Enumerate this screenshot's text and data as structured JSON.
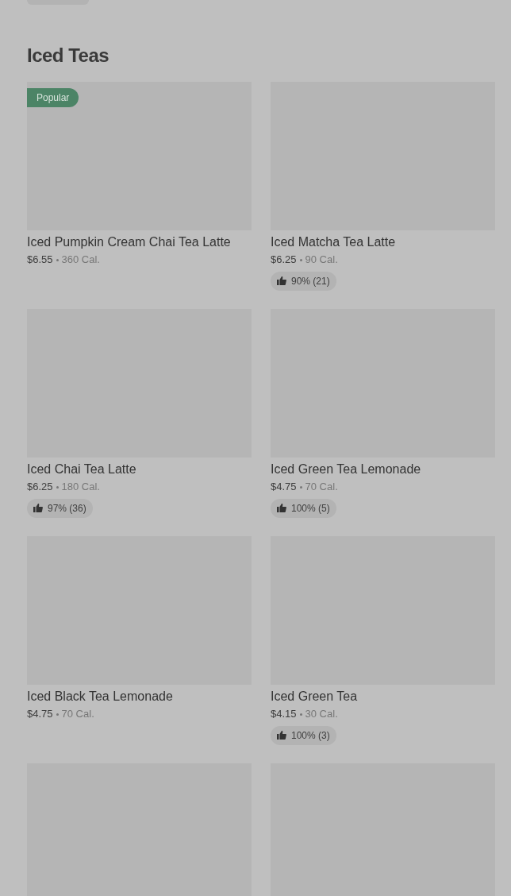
{
  "section": {
    "title": "Iced Teas"
  },
  "items": [
    {
      "kind": "product",
      "badge": "Popular",
      "name": "Iced Pumpkin Cream Chai Tea Latte",
      "price": "$6.55",
      "calories": "360 Cal."
    },
    {
      "kind": "product",
      "name": "Iced Matcha Tea Latte",
      "price": "$6.25",
      "calories": "90 Cal.",
      "rating": "90% (21)"
    },
    {
      "kind": "product",
      "name": "Iced Chai Tea Latte",
      "price": "$6.25",
      "calories": "180 Cal.",
      "rating": "97% (36)"
    },
    {
      "kind": "product",
      "name": "Iced Green Tea Lemonade",
      "price": "$4.75",
      "calories": "70 Cal.",
      "rating": "100% (5)"
    },
    {
      "kind": "product",
      "name": "Iced Black Tea Lemonade",
      "price": "$4.75",
      "calories": "70 Cal."
    },
    {
      "kind": "product",
      "name": "Iced Green Tea",
      "price": "$4.15",
      "calories": "30 Cal.",
      "rating": "100% (3)"
    },
    {
      "kind": "picture"
    },
    {
      "kind": "picture"
    }
  ]
}
